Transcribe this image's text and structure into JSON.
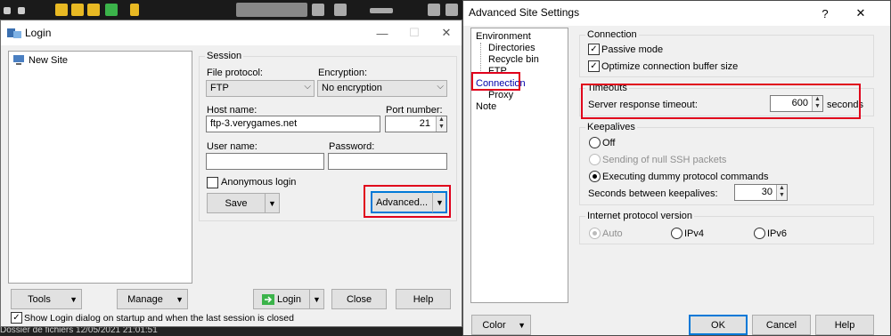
{
  "background": {
    "bottom_text": "Dossier de fichiers     12/05/2021 21:01:51"
  },
  "login": {
    "title": "Login",
    "tree": {
      "new_site": "New Site"
    },
    "session": {
      "group_title": "Session",
      "file_protocol_label": "File protocol:",
      "file_protocol_value": "FTP",
      "encryption_label": "Encryption:",
      "encryption_value": "No encryption",
      "host_label": "Host name:",
      "host_value": "ftp-3.verygames.net",
      "port_label": "Port number:",
      "port_value": "21",
      "user_label": "User name:",
      "user_value": "",
      "password_label": "Password:",
      "password_value": "",
      "anonymous_label": "Anonymous login",
      "save_label": "Save",
      "advanced_label": "Advanced..."
    },
    "buttons": {
      "tools": "Tools",
      "manage": "Manage",
      "login": "Login",
      "close": "Close",
      "help": "Help"
    },
    "show_login_label": "Show Login dialog on startup and when the last session is closed"
  },
  "advanced": {
    "title": "Advanced Site Settings",
    "help_glyph": "?",
    "close_glyph": "✕",
    "tree": {
      "environment": "Environment",
      "directories": "Directories",
      "recycle_bin": "Recycle bin",
      "ftp": "FTP",
      "connection": "Connection",
      "proxy": "Proxy",
      "note": "Note"
    },
    "connection": {
      "group_title": "Connection",
      "passive_label": "Passive mode",
      "optimize_label": "Optimize connection buffer size"
    },
    "timeouts": {
      "group_title": "Timeouts",
      "label": "Server response timeout:",
      "value": "600",
      "unit": "seconds"
    },
    "keepalives": {
      "group_title": "Keepalives",
      "off_label": "Off",
      "null_ssh_label": "Sending of null SSH packets",
      "dummy_label": "Executing dummy protocol commands",
      "seconds_label": "Seconds between keepalives:",
      "seconds_value": "30"
    },
    "ip_version": {
      "group_title": "Internet protocol version",
      "auto": "Auto",
      "ipv4": "IPv4",
      "ipv6": "IPv6"
    },
    "buttons": {
      "color": "Color",
      "ok": "OK",
      "cancel": "Cancel",
      "help": "Help"
    }
  },
  "colors": {
    "highlight_red": "#e0001b",
    "selection_blue": "#0078d7"
  }
}
